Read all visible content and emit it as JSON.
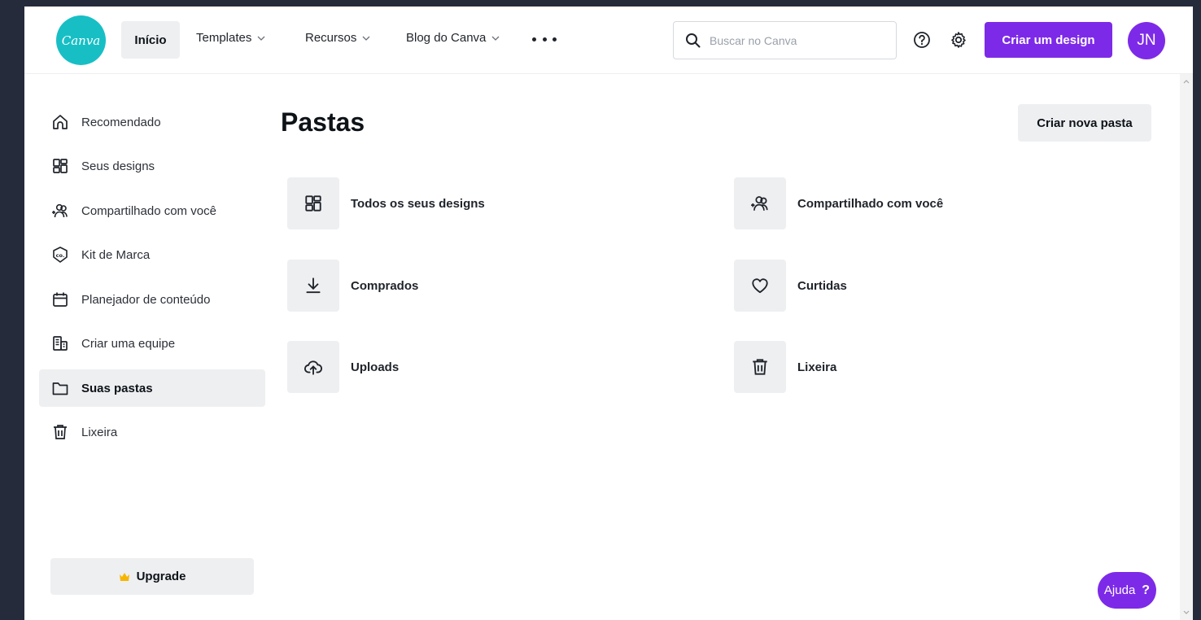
{
  "header": {
    "logo_text": "Canva",
    "home_label": "Início",
    "nav": [
      {
        "label": "Templates"
      },
      {
        "label": "Recursos"
      },
      {
        "label": "Blog do Canva"
      }
    ],
    "search_placeholder": "Buscar no Canva",
    "create_label": "Criar um design",
    "avatar_initials": "JN"
  },
  "sidebar": {
    "items": [
      {
        "label": "Recomendado",
        "icon": "home-icon"
      },
      {
        "label": "Seus designs",
        "icon": "grid-icon"
      },
      {
        "label": "Compartilhado com você",
        "icon": "shared-users-icon"
      },
      {
        "label": "Kit de Marca",
        "icon": "brand-kit-icon"
      },
      {
        "label": "Planejador de conteúdo",
        "icon": "calendar-icon"
      },
      {
        "label": "Criar uma equipe",
        "icon": "team-building-icon"
      },
      {
        "label": "Suas pastas",
        "icon": "folder-icon",
        "active": true
      },
      {
        "label": "Lixeira",
        "icon": "trash-icon"
      }
    ],
    "upgrade_label": "Upgrade"
  },
  "main": {
    "title": "Pastas",
    "new_folder_label": "Criar nova pasta",
    "folders": [
      {
        "label": "Todos os seus designs",
        "icon": "grid-icon"
      },
      {
        "label": "Compartilhado com você",
        "icon": "shared-users-icon"
      },
      {
        "label": "Comprados",
        "icon": "download-icon"
      },
      {
        "label": "Curtidas",
        "icon": "heart-icon"
      },
      {
        "label": "Uploads",
        "icon": "cloud-upload-icon"
      },
      {
        "label": "Lixeira",
        "icon": "trash-icon"
      }
    ]
  },
  "help": {
    "label": "Ajuda",
    "mark": "?"
  },
  "colors": {
    "brand_purple": "#7d2ae8",
    "logo_teal": "#17bfc5",
    "frame_bg": "#252b3b"
  }
}
